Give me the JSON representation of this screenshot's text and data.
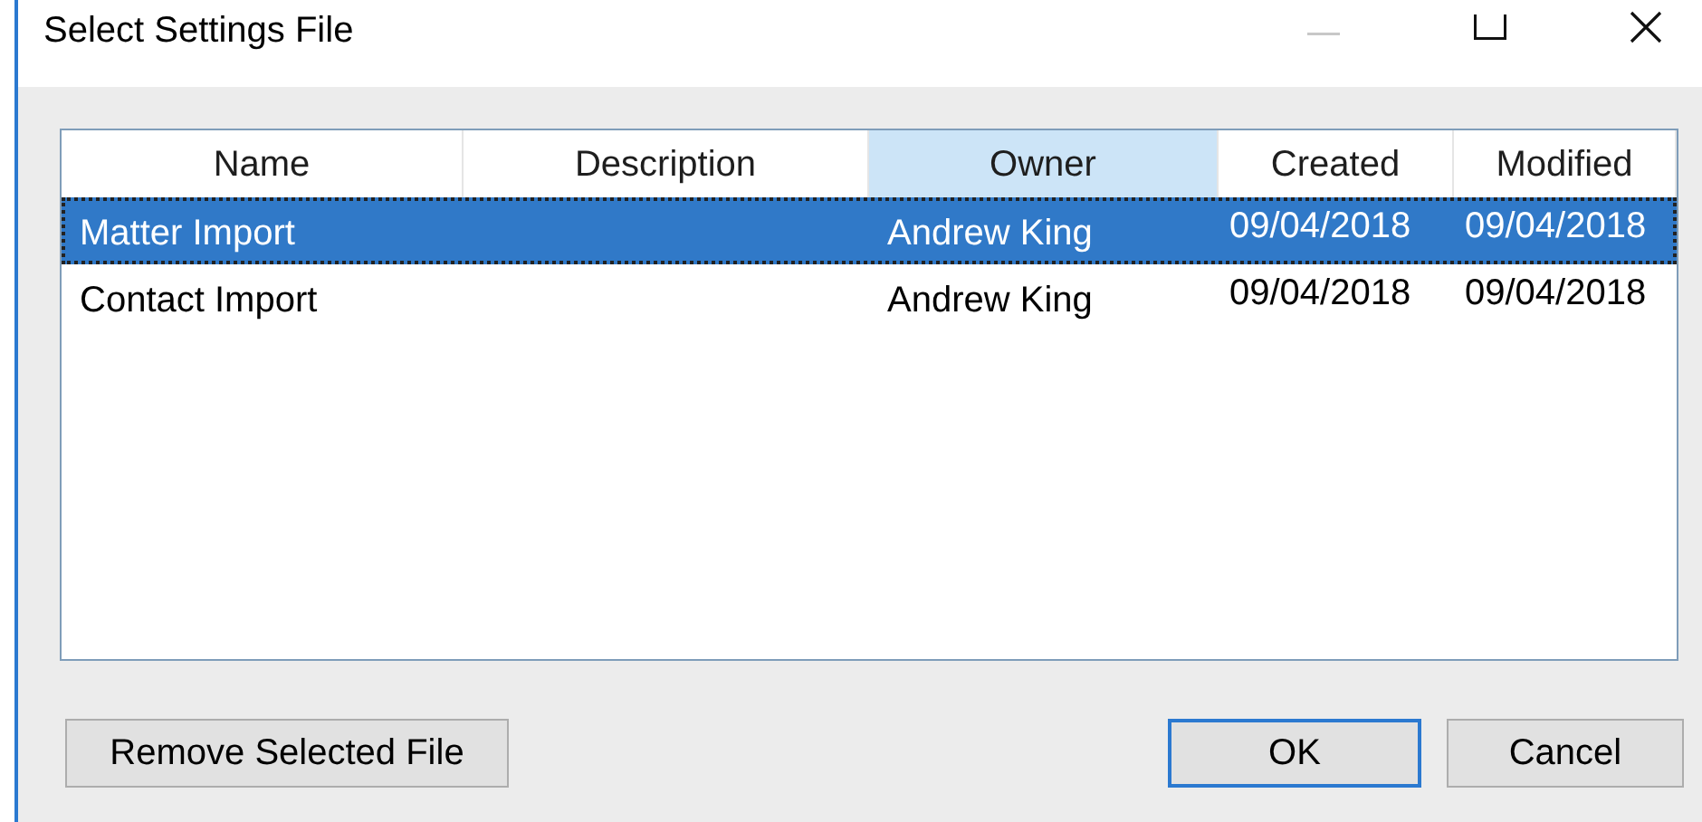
{
  "window": {
    "title": "Select Settings File"
  },
  "table": {
    "columns": [
      {
        "label": "Name",
        "highlighted": false
      },
      {
        "label": "Description",
        "highlighted": false
      },
      {
        "label": "Owner",
        "highlighted": true
      },
      {
        "label": "Created",
        "highlighted": false
      },
      {
        "label": "Modified",
        "highlighted": false
      }
    ],
    "rows": [
      {
        "cells": [
          "Matter Import",
          "",
          "Andrew King",
          "09/04/2018",
          "09/04/2018"
        ],
        "selected": true
      },
      {
        "cells": [
          "Contact Import",
          "",
          "Andrew King",
          "09/04/2018",
          "09/04/2018"
        ],
        "selected": false
      }
    ]
  },
  "buttons": [
    {
      "label": "Remove Selected File",
      "default": false
    },
    {
      "label": "OK",
      "default": true
    },
    {
      "label": "Cancel",
      "default": false
    }
  ]
}
